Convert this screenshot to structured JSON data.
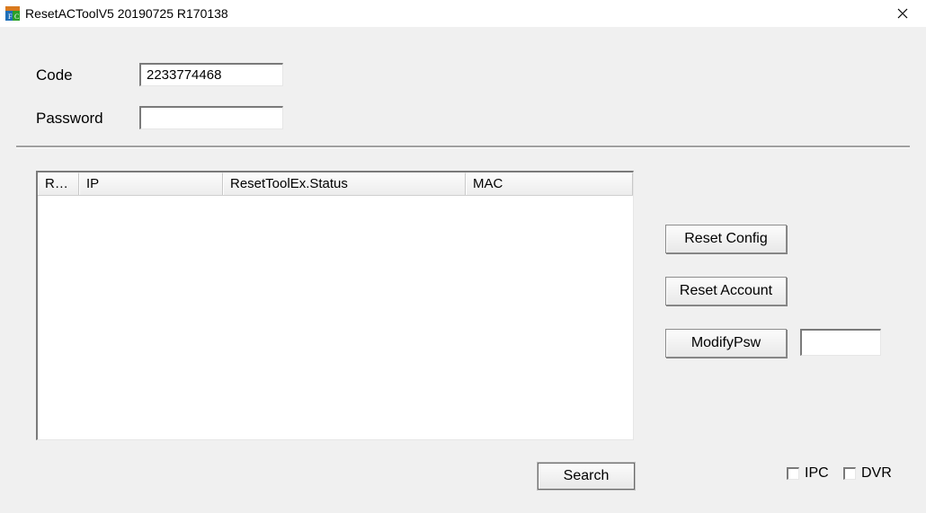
{
  "window": {
    "title": "ResetACToolV5 20190725 R170138"
  },
  "form": {
    "code_label": "Code",
    "code_value": "2233774468",
    "password_label": "Password",
    "password_value": ""
  },
  "table": {
    "columns": {
      "re": "Re...",
      "ip": "IP",
      "status": "ResetToolEx.Status",
      "mac": "MAC"
    },
    "rows": []
  },
  "buttons": {
    "reset_config": "Reset Config",
    "reset_account": "Reset Account",
    "modify_psw": "ModifyPsw",
    "search": "Search"
  },
  "modify_psw_value": "",
  "checkboxes": {
    "ipc": {
      "label": "IPC",
      "checked": false
    },
    "dvr": {
      "label": "DVR",
      "checked": false
    }
  }
}
